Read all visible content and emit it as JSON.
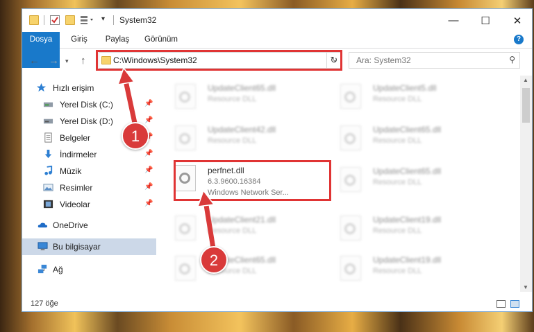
{
  "window": {
    "title": "System32",
    "tabs": [
      "Dosya",
      "Giriş",
      "Paylaş",
      "Görünüm"
    ],
    "help": "?"
  },
  "nav": {
    "address": "C:\\Windows\\System32",
    "search_placeholder": "Ara: System32"
  },
  "sidebar": {
    "items": [
      {
        "label": "Hızlı erişim",
        "icon": "star-icon",
        "pinned": false
      },
      {
        "label": "Yerel Disk (C:)",
        "icon": "drive-icon",
        "pinned": true
      },
      {
        "label": "Yerel Disk (D:)",
        "icon": "drive-icon",
        "pinned": true
      },
      {
        "label": "Belgeler",
        "icon": "documents-icon",
        "pinned": true
      },
      {
        "label": "İndirmeler",
        "icon": "download-icon",
        "pinned": true
      },
      {
        "label": "Müzik",
        "icon": "music-icon",
        "pinned": true
      },
      {
        "label": "Resimler",
        "icon": "pictures-icon",
        "pinned": true
      },
      {
        "label": "Videolar",
        "icon": "videos-icon",
        "pinned": true
      },
      {
        "label": "OneDrive",
        "icon": "cloud-icon",
        "pinned": false
      },
      {
        "label": "Bu bilgisayar",
        "icon": "computer-icon",
        "pinned": false,
        "selected": true
      },
      {
        "label": "Ağ",
        "icon": "network-icon",
        "pinned": false
      }
    ]
  },
  "files": {
    "col1": [
      {
        "name": "UpdateClient65.dll",
        "sub": "Resource DLL"
      },
      {
        "name": "UpdateClient42.dll",
        "sub": "Resource DLL"
      },
      {
        "name": "perfnet.dll",
        "sub": "6.3.9600.16384",
        "sub2": "Windows Network Ser..."
      },
      {
        "name": "UpdateClient21.dll",
        "sub": "Resource DLL"
      },
      {
        "name": "UpdateClient65.dll",
        "sub": "Resource DLL"
      }
    ],
    "col2": [
      {
        "name": "UpdateClient5.dll",
        "sub": "Resource DLL"
      },
      {
        "name": "UpdateClient65.dll",
        "sub": "Resource DLL"
      },
      {
        "name": "UpdateClient65.dll",
        "sub": "Resource DLL"
      },
      {
        "name": "UpdateClient19.dll",
        "sub": "Resource DLL"
      },
      {
        "name": "UpdateClient19.dll",
        "sub": "Resource DLL"
      }
    ]
  },
  "status": {
    "count": "127 öğe"
  },
  "callouts": [
    "1",
    "2"
  ],
  "colors": {
    "accent": "#1979ca",
    "highlight": "#e03434",
    "badge": "#d93a3a",
    "selected": "#ccd8e8"
  }
}
